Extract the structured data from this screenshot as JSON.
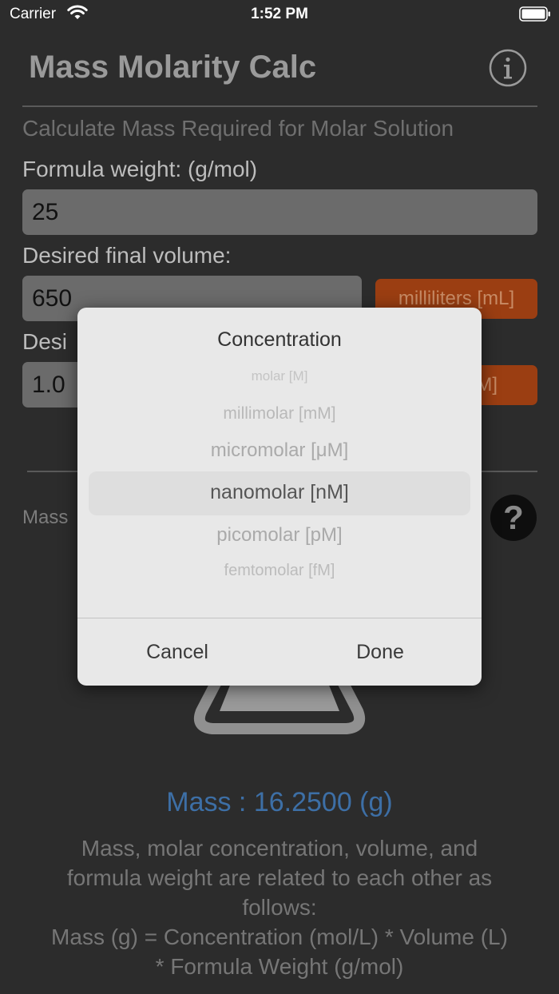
{
  "status_bar": {
    "carrier": "Carrier",
    "time": "1:52 PM"
  },
  "header": {
    "title": "Mass Molarity Calc",
    "info_icon": "info-circle-icon"
  },
  "form": {
    "subtitle": "Calculate Mass Required for Molar Solution",
    "formula_weight_label": "Formula weight:  (g/mol)",
    "formula_weight_value": "25",
    "volume_label": "Desired final volume:",
    "volume_value": "650",
    "volume_unit": "milliliters [mL]",
    "concentration_label_visible": "Desi",
    "concentration_value": "1.0",
    "concentration_unit_visible": "M]"
  },
  "result": {
    "label_visible": "Mass",
    "help_icon": "question-mark-icon",
    "mass_text": "Mass : 16.2500 (g)",
    "explanation_lines": [
      "Mass, molar concentration, volume, and",
      "formula weight are related to each other as",
      "follows:",
      "Mass (g) = Concentration (mol/L) * Volume (L)",
      "* Formula Weight (g/mol)"
    ]
  },
  "picker": {
    "title": "Concentration",
    "options": [
      "molar [M]",
      "millimolar [mM]",
      "micromolar [μM]",
      "nanomolar [nM]",
      "picomolar [pM]",
      "femtomolar [fM]"
    ],
    "selected": "nanomolar [nM]",
    "cancel_label": "Cancel",
    "done_label": "Done"
  },
  "colors": {
    "accent_orange": "#9b3e12",
    "result_blue": "#3d6fa6",
    "background": "#2c2c2c"
  }
}
